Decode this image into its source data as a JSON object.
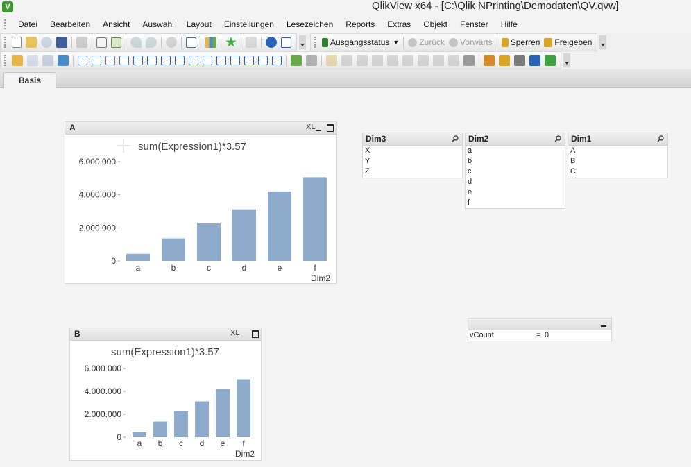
{
  "window": {
    "title": "QlikView x64 - [C:\\Qlik NPrinting\\Demodaten\\QV.qvw]",
    "app_icon_letter": "V"
  },
  "menu": [
    "Datei",
    "Bearbeiten",
    "Ansicht",
    "Auswahl",
    "Layout",
    "Einstellungen",
    "Lesezeichen",
    "Reports",
    "Extras",
    "Objekt",
    "Fenster",
    "Hilfe"
  ],
  "toolbar1": {
    "icons": [
      "new-document-icon",
      "open-folder-icon",
      "reload-icon",
      "save-icon",
      "print-icon",
      "edit-script-icon",
      "reload-script-icon",
      "undo-icon",
      "redo-icon",
      "search-icon",
      "select-fields-icon",
      "sheet-properties-icon",
      "bookmark-star-icon",
      "edit-icon",
      "help-icon",
      "context-help-icon"
    ],
    "status_label": "Ausgangsstatus",
    "back_label": "Zurück",
    "forward_label": "Vorwärts",
    "lock_label": "Sperren",
    "unlock_label": "Freigeben"
  },
  "toolbar2": {
    "icons": [
      "new-sheet-icon",
      "promote-sheet-icon",
      "demote-sheet-icon",
      "sheet-props-icon",
      "listbox-icon",
      "statistics-box-icon",
      "table-box-icon",
      "multi-box-icon",
      "chart-icon",
      "input-box-icon",
      "current-selections-icon",
      "button-icon",
      "text-object-icon",
      "line-arrow-icon",
      "slider-icon",
      "bookmark-object-icon",
      "search-object-icon",
      "container-icon",
      "custom-object-icon",
      "chart-wizard-icon",
      "format-painter-icon",
      "align-icon",
      "align-left-icon",
      "align-center-icon",
      "align-right-icon",
      "align-top-icon",
      "align-middle-icon",
      "align-bottom-icon",
      "distribute-h-icon",
      "distribute-v-icon",
      "design-grid-icon",
      "export-icon",
      "new-object-icon",
      "properties-icon",
      "dependencies-icon",
      "report-icon"
    ]
  },
  "tab": {
    "label": "Basis"
  },
  "charts": [
    {
      "caption": "A",
      "xl_label": "XL",
      "title": "sum(Expression1)*3.57",
      "dim_label": "Dim2",
      "tick_labels": [
        "6.000.000",
        "4.000.000",
        "2.000.000",
        "0"
      ]
    },
    {
      "caption": "B",
      "xl_label": "XL",
      "title": "sum(Expression1)*3.57",
      "dim_label": "Dim2",
      "tick_labels": [
        "6.000.000",
        "4.000.000",
        "2.000.000",
        "0"
      ]
    }
  ],
  "chart_data": [
    {
      "type": "bar",
      "title": "sum(Expression1)*3.57",
      "xlabel": "Dim2",
      "ylabel": "",
      "categories": [
        "a",
        "b",
        "c",
        "d",
        "e",
        "f"
      ],
      "values": [
        430000,
        1360000,
        2270000,
        3120000,
        4200000,
        5060000
      ],
      "ylim": [
        0,
        6000000
      ],
      "grid": false,
      "color": "#8eabcc"
    },
    {
      "type": "bar",
      "title": "sum(Expression1)*3.57",
      "xlabel": "Dim2",
      "ylabel": "",
      "categories": [
        "a",
        "b",
        "c",
        "d",
        "e",
        "f"
      ],
      "values": [
        430000,
        1360000,
        2270000,
        3120000,
        4200000,
        5060000
      ],
      "ylim": [
        0,
        6000000
      ],
      "grid": false,
      "color": "#8eabcc"
    }
  ],
  "listboxes": [
    {
      "caption": "Dim3",
      "items": [
        "X",
        "Y",
        "Z"
      ]
    },
    {
      "caption": "Dim2",
      "items": [
        "a",
        "b",
        "c",
        "d",
        "e",
        "f"
      ]
    },
    {
      "caption": "Dim1",
      "items": [
        "A",
        "B",
        "C"
      ]
    }
  ],
  "inputbox": {
    "variable": "vCount",
    "equals": "=",
    "value": "0"
  },
  "colors": {
    "bar": "#8eabcc",
    "accent_green": "#3d9a2f"
  }
}
